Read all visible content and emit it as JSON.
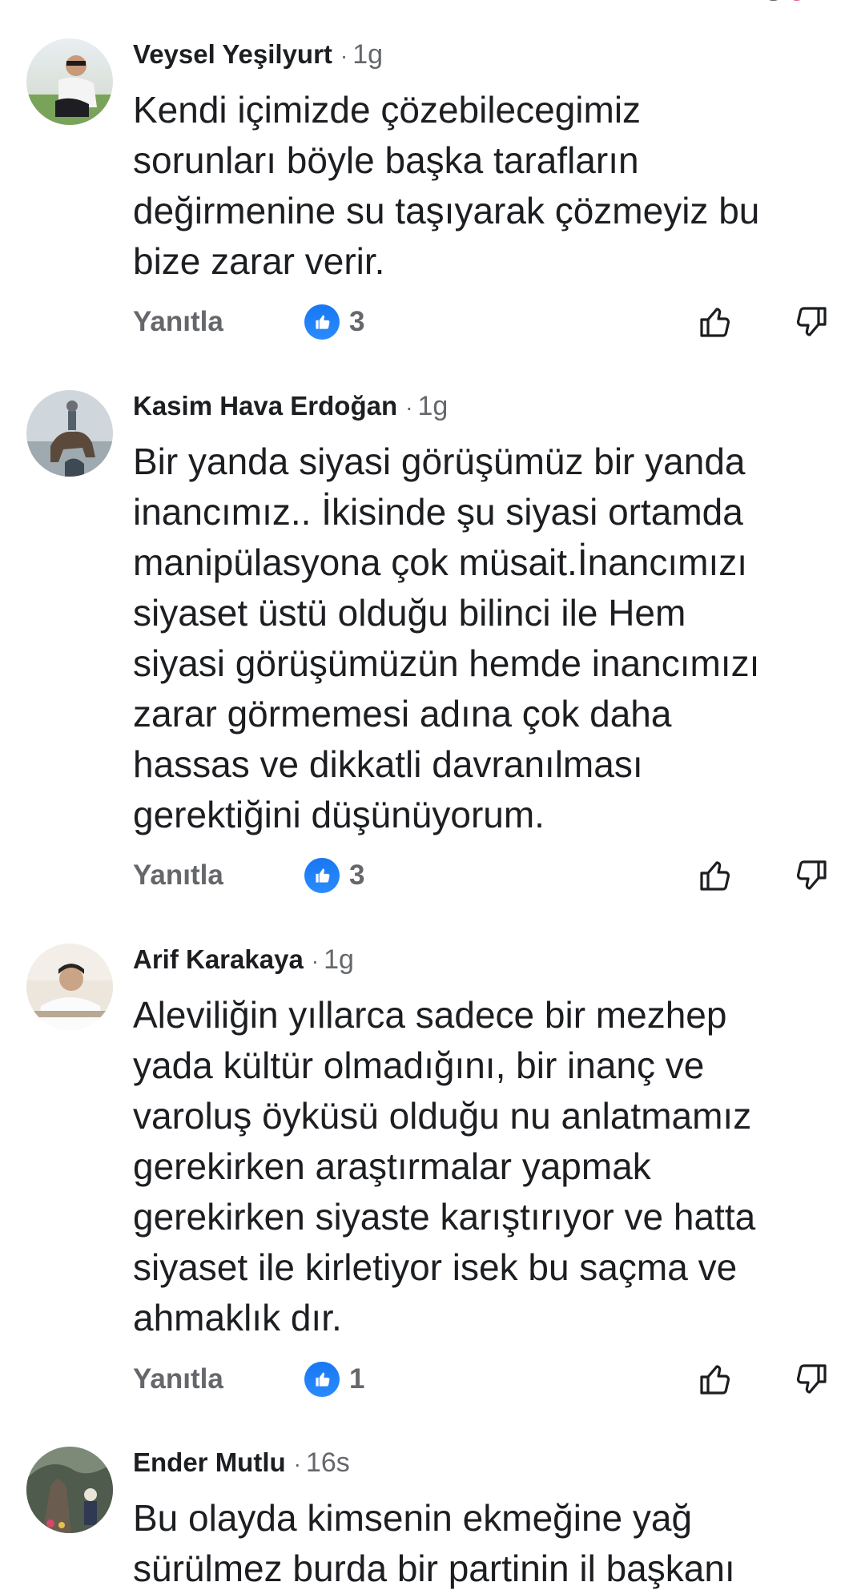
{
  "comments": [
    {
      "author": "Veysel Yeşilyurt",
      "time": "1g",
      "text": "Kendi içimizde çözebilecegimiz\nsorunları böyle başka tarafların\ndeğirmenine su taşıyarak çözmeyiz bu\nbize zarar verir.",
      "reply_label": "Yanıtla",
      "like_count": "3"
    },
    {
      "author": "Kasim Hava Erdoğan",
      "time": "1g",
      "text": "Bir yanda siyasi görüşümüz bir yanda\ninancımız.. İkisinde şu siyasi ortamda\nmanipülasyona çok müsait.İnancımızı\nsiyaset üstü olduğu bilinci ile Hem\nsiyasi görüşümüzün hemde inancımızı\nzarar görmemesi adına çok daha\nhassas ve dikkatli davranılması\ngerektiğini düşünüyorum.",
      "reply_label": "Yanıtla",
      "like_count": "3"
    },
    {
      "author": "Arif Karakaya",
      "time": "1g",
      "text": "Aleviliğin yıllarca sadece bir mezhep\nyada kültür olmadığını, bir inanç ve\nvaroluş öyküsü olduğu nu anlatmamız\ngerekirken araştırmalar yapmak\ngerekirken siyaste karıştırıyor ve hatta\nsiyaset ile kirletiyor isek bu saçma ve\nahmaklık dır.",
      "reply_label": "Yanıtla",
      "like_count": "1"
    },
    {
      "author": "Ender Mutlu",
      "time": "16s",
      "text": "Bu olayda kimsenin ekmeğine yağ\nsürülmez burda bir partinin il başkanı"
    }
  ],
  "colors": {
    "text": "#1c1e21",
    "secondary": "#65676b",
    "like_blue": "#1877f2"
  },
  "icons": {
    "like_badge": "thumbs-up-icon",
    "like_button": "thumb-up-outline-icon",
    "dislike_button": "thumb-down-outline-icon"
  }
}
